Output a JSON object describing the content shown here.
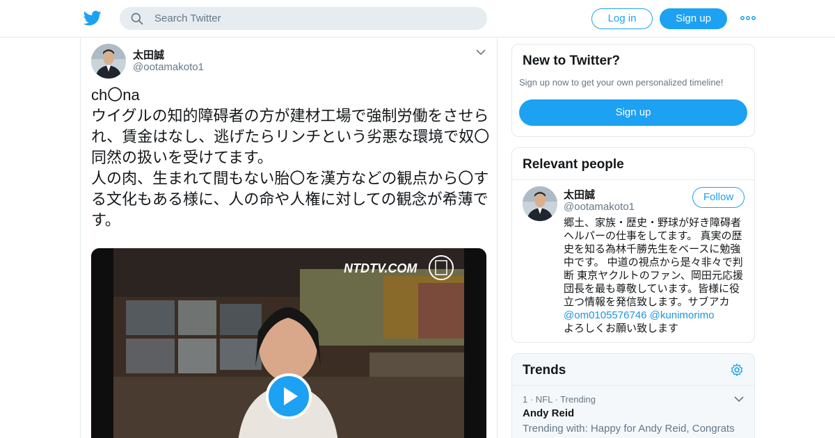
{
  "header": {
    "search_placeholder": "Search Twitter",
    "login_label": "Log in",
    "signup_label": "Sign up",
    "brand_color": "#1da1f2"
  },
  "tweet": {
    "author_name": "太田誠",
    "author_handle": "@ootamakoto1",
    "text": "ch〇na\nウイグルの知的障碍者の方が建材工場で強制労働をさせられ、賃金はなし、逃げたらリンチという劣悪な環境で奴〇同然の扱いを受けてます。\n人の肉、生まれて間もない胎〇を漢方などの観点から〇する文化もある様に、人の命や人権に対しての観念が希薄です。",
    "video_watermark": "NTDTV.COM"
  },
  "new_to_twitter": {
    "title": "New to Twitter?",
    "subtitle": "Sign up now to get your own personalized timeline!",
    "button_label": "Sign up"
  },
  "relevant_people": {
    "title": "Relevant people",
    "person": {
      "name": "太田誠",
      "handle": "@ootamakoto1",
      "follow_label": "Follow",
      "bio_text": "郷土、家族・歴史・野球が好き障碍者ヘルパーの仕事をしてます。 真実の歴史を知る為林千勝先生をベースに勉強中です。 中道の視点から是々非々で判断 東京ヤクルトのファン、岡田元応援団長を最も尊敬しています。皆様に役立つ情報を発信致します。サブアカ",
      "bio_link1": "@om0105576746",
      "bio_link2": "@kunimorimo",
      "bio_tail": "よろしくお願い致します"
    }
  },
  "trends": {
    "title": "Trends",
    "items": [
      {
        "meta": "1 · NFL · Trending",
        "name": "Andy Reid",
        "with": "Trending with: Happy for Andy Reid, Congrats to Andy Reid, Congrats Andy Reid"
      }
    ]
  }
}
